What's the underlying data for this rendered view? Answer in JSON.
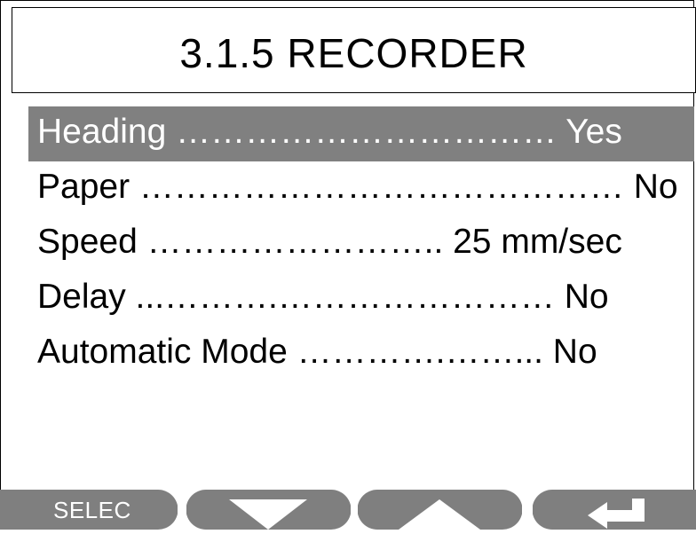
{
  "screen": {
    "title": "3.1.5 RECORDER"
  },
  "menu": {
    "items": [
      {
        "text": "Heading …………………………… Yes",
        "selected": true
      },
      {
        "text": "Paper …………………………………… No",
        "selected": false
      },
      {
        "text": "Speed …………………….. 25 mm/sec",
        "selected": false
      },
      {
        "text": "Delay ...……….…………………… No",
        "selected": false
      },
      {
        "text": "Automatic Mode ………….……... No",
        "selected": false
      }
    ]
  },
  "softkeys": {
    "select_label": "SELEC",
    "down_icon": "triangle-down-icon",
    "up_icon": "triangle-up-icon",
    "enter_icon": "return-arrow-icon"
  },
  "colors": {
    "selected_row": "#808080",
    "softkey": "#7f7f7f",
    "text": "#000000",
    "selected_text": "#ffffff"
  }
}
